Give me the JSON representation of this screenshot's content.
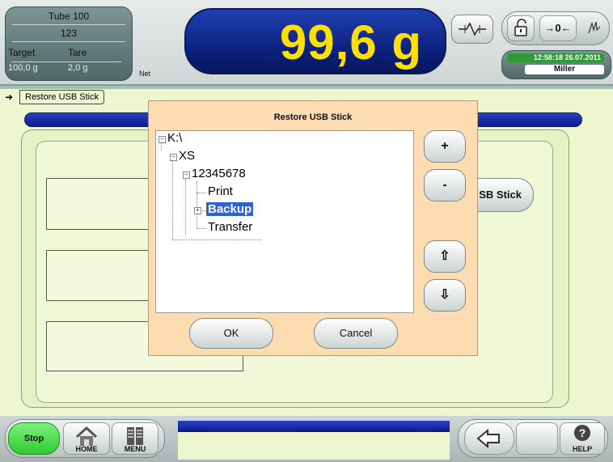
{
  "header": {
    "product_name": "Tube 100",
    "product_id": "123",
    "target_label": "Target",
    "tare_label": "Tare",
    "target_value": "100,0 g",
    "tare_value": "2,0 g",
    "net_label": "Net",
    "weight_value": "99,6 g",
    "zero_label": "→0←",
    "datetime": "12:58:18  26.07.2011",
    "user": "Miller",
    "icons": [
      "scale-level-icon",
      "unlock-icon",
      "zero-icon",
      "tare-hand-icon"
    ]
  },
  "main": {
    "breadcrumb": "Restore USB Stick",
    "usb_button_label": "SB Stick"
  },
  "dialog": {
    "title": "Restore USB Stick",
    "tree": [
      {
        "label": "K:\\",
        "level": 0,
        "expander": "−"
      },
      {
        "label": "XS",
        "level": 1,
        "expander": "−"
      },
      {
        "label": "12345678",
        "level": 2,
        "expander": "−"
      },
      {
        "label": "Print",
        "level": 3,
        "expander": ""
      },
      {
        "label": "Backup",
        "level": 3,
        "expander": "+",
        "selected": true
      },
      {
        "label": "Transfer",
        "level": 3,
        "expander": ""
      }
    ],
    "plus_label": "+",
    "minus_label": "-",
    "up_label": "⇧",
    "down_label": "⇩",
    "ok_label": "OK",
    "cancel_label": "Cancel"
  },
  "footer": {
    "stop_label": "Stop",
    "home_label": "HOME",
    "menu_label": "MENU",
    "help_label": "HELP",
    "help_glyph": "?",
    "back_glyph": "⇦"
  },
  "colors": {
    "weight_bg": "#0b1f7a",
    "weight_text": "#ffe000",
    "selection": "#2f62d6",
    "dialog_bg": "#fcdcb0",
    "stop_green": "#2fcb2f",
    "panel_bg": "#eef6d0"
  }
}
